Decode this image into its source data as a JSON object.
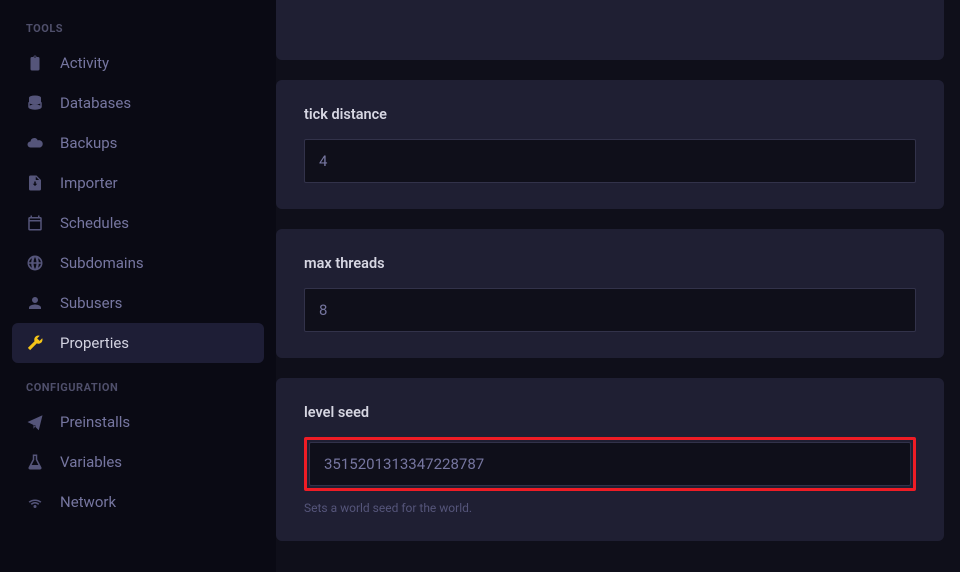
{
  "sidebar": {
    "sections": {
      "tools": {
        "heading": "TOOLS",
        "items": [
          {
            "label": "Activity",
            "icon": "clipboard"
          },
          {
            "label": "Databases",
            "icon": "database"
          },
          {
            "label": "Backups",
            "icon": "cloud"
          },
          {
            "label": "Importer",
            "icon": "file-download"
          },
          {
            "label": "Schedules",
            "icon": "calendar"
          },
          {
            "label": "Subdomains",
            "icon": "globe"
          },
          {
            "label": "Subusers",
            "icon": "user"
          },
          {
            "label": "Properties",
            "icon": "wrench",
            "active": true
          }
        ]
      },
      "configuration": {
        "heading": "CONFIGURATION",
        "items": [
          {
            "label": "Preinstalls",
            "icon": "paper-plane"
          },
          {
            "label": "Variables",
            "icon": "flask"
          },
          {
            "label": "Network",
            "icon": "wifi"
          }
        ]
      }
    }
  },
  "properties": {
    "tick_distance": {
      "label": "tick distance",
      "value": "4"
    },
    "max_threads": {
      "label": "max threads",
      "value": "8"
    },
    "level_seed": {
      "label": "level seed",
      "value": "3515201313347228787",
      "help": "Sets a world seed for the world."
    }
  }
}
